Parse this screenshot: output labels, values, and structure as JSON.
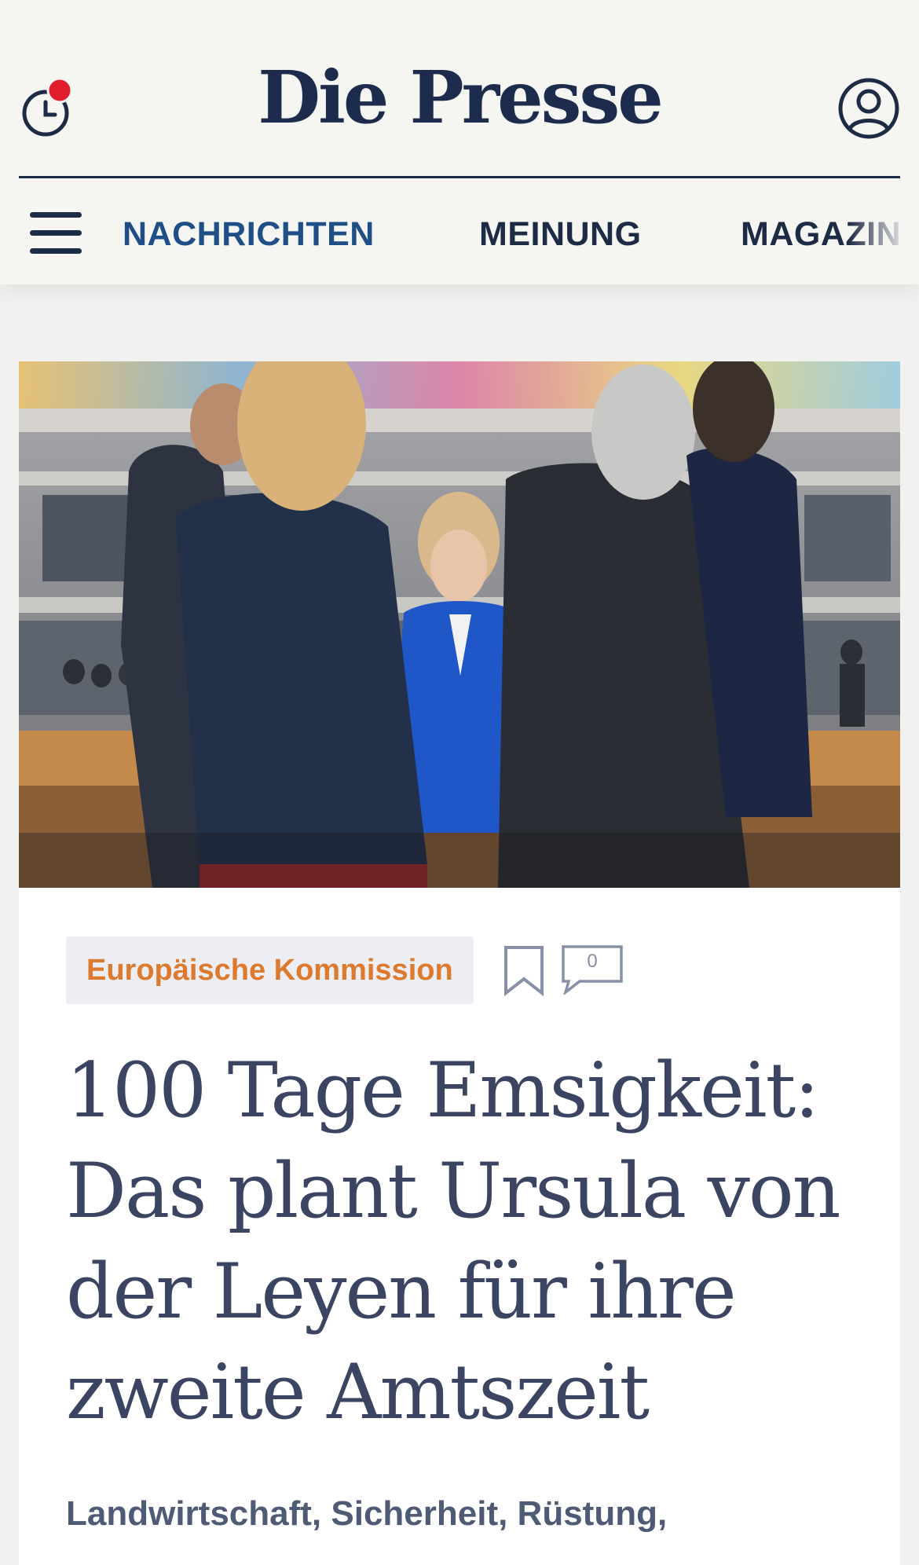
{
  "header": {
    "brand": "Die Presse",
    "notification_dot_color": "#e01d2b",
    "icons": {
      "left": "clock-icon",
      "right": "user-icon"
    }
  },
  "nav": {
    "menu_icon": "hamburger-menu-icon",
    "items": [
      {
        "label": "NACHRICHTEN",
        "active": true
      },
      {
        "label": "MEINUNG",
        "active": false
      },
      {
        "label": "MAGAZIN",
        "active": false
      }
    ]
  },
  "article": {
    "image_alt": "Politicians standing in a conference hall, woman in blue jacket in the center",
    "tag": "Europäische Kommission",
    "bookmark_icon": "bookmark-icon",
    "comment_icon": "comment-icon",
    "comment_count": "0",
    "headline": "100 Tage Emsigkeit: Das plant Ursula von der Leyen für ihre zweite Amtszeit",
    "keywords": "Landwirtschaft, Sicherheit, Rüstung,"
  },
  "colors": {
    "brand_navy": "#1d2c4c",
    "nav_active": "#1f4f86",
    "tag_text": "#dd7a2d",
    "tag_bg": "#eceef3",
    "headline": "#3b4460"
  }
}
